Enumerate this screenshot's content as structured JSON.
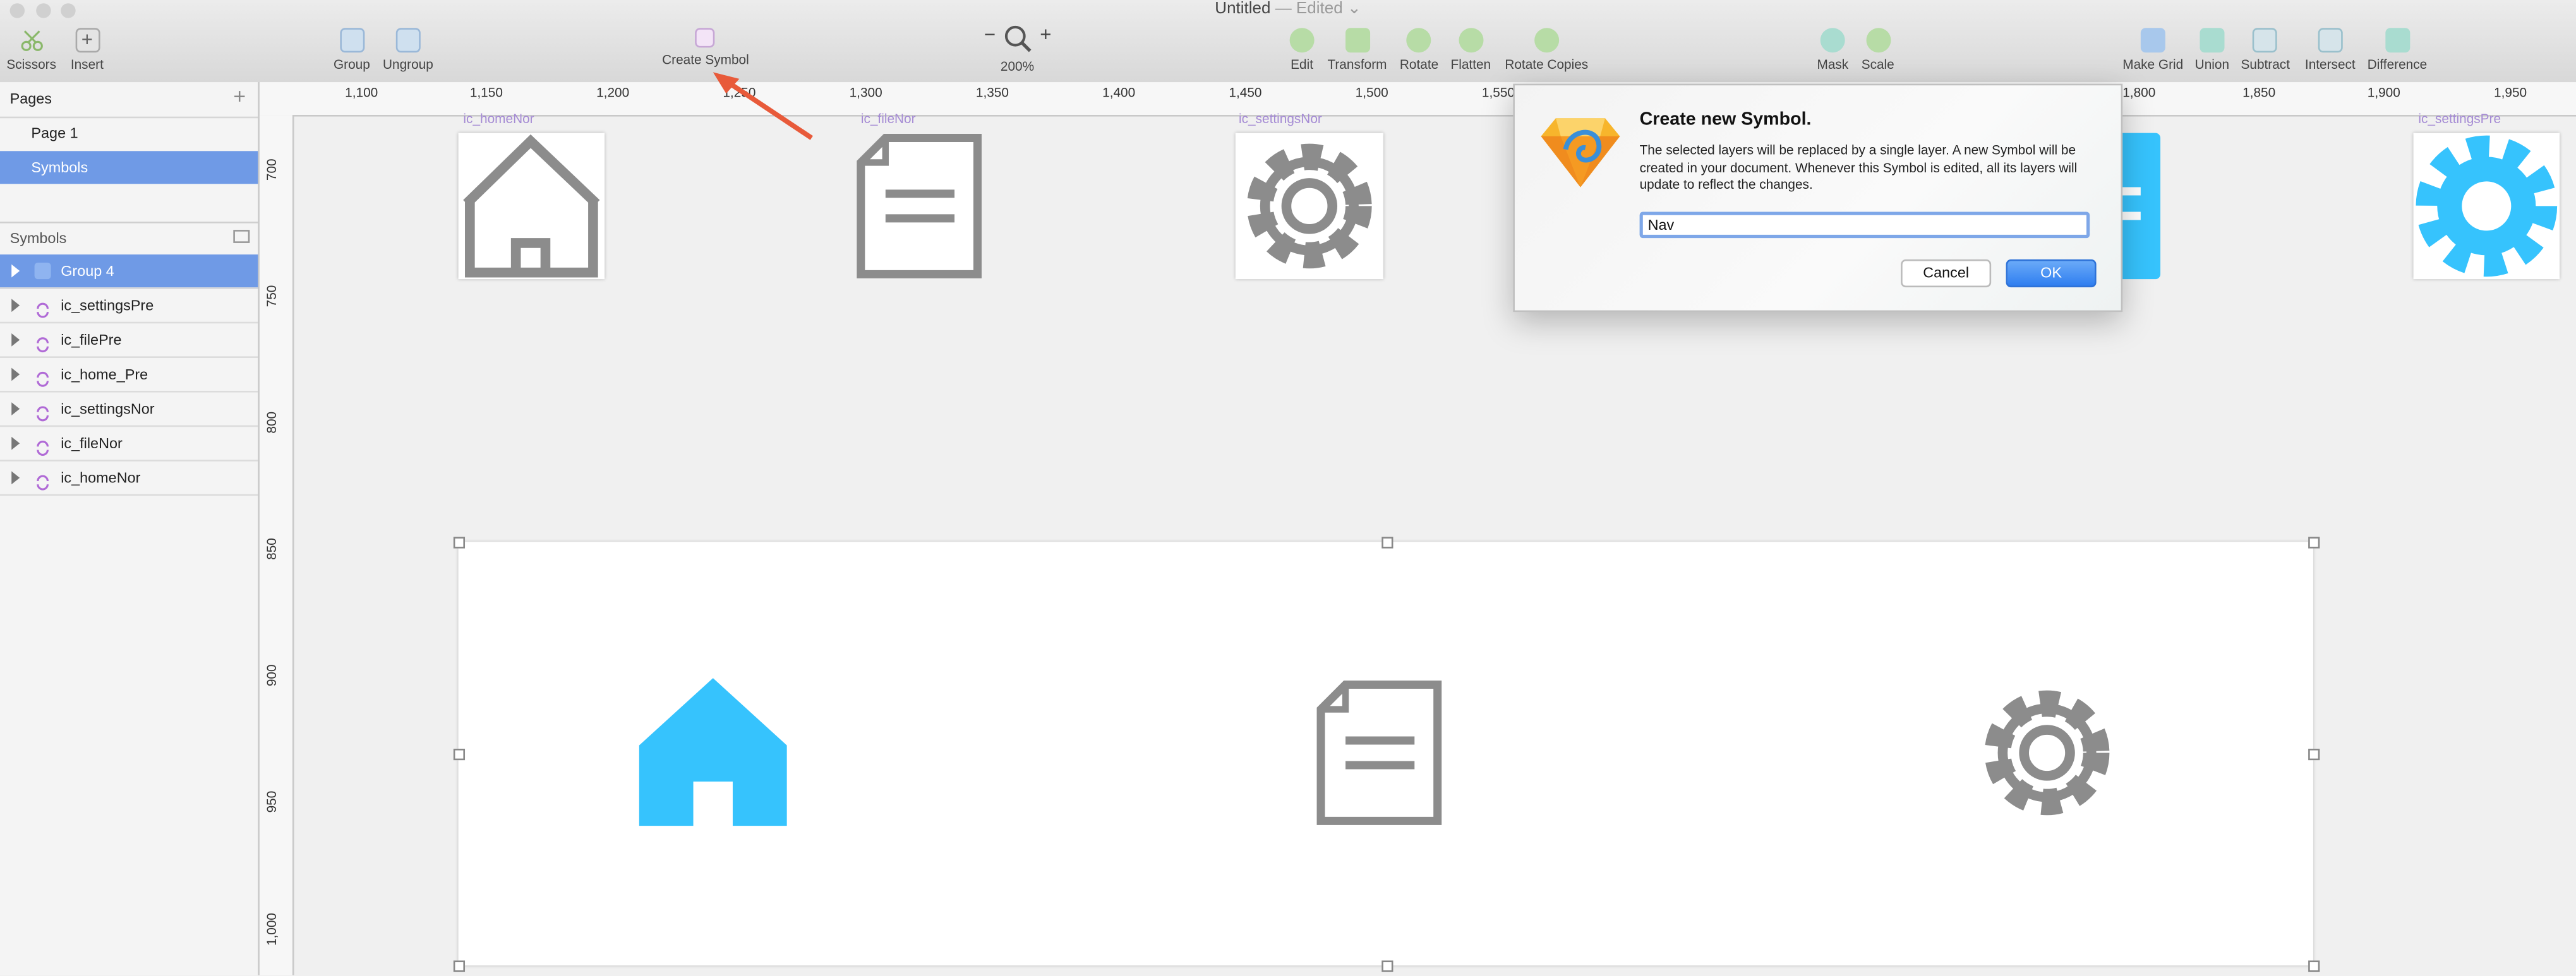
{
  "window": {
    "title": "Untitled",
    "status": " — Edited",
    "chevron": "⌄"
  },
  "toolbar": {
    "scissors": "Scissors",
    "insert": "Insert",
    "group": "Group",
    "ungroup": "Ungroup",
    "create_symbol": "Create Symbol",
    "zoom_out": "−",
    "zoom_in": "+",
    "zoom": "200%",
    "edit": "Edit",
    "transform": "Transform",
    "rotate": "Rotate",
    "flatten": "Flatten",
    "rotate_copies": "Rotate Copies",
    "mask": "Mask",
    "scale": "Scale",
    "make_grid": "Make Grid",
    "union": "Union",
    "subtract": "Subtract",
    "intersect": "Intersect",
    "difference": "Difference"
  },
  "pages": {
    "header": "Pages",
    "add": "+",
    "items": [
      "Page 1",
      "Symbols"
    ],
    "selected": "Symbols"
  },
  "symbols_panel": {
    "header": "Symbols",
    "layers": [
      "Group 4",
      "ic_settingsPre",
      "ic_filePre",
      "ic_home_Pre",
      "ic_settingsNor",
      "ic_fileNor",
      "ic_homeNor"
    ]
  },
  "ruler": {
    "top": [
      "1,100",
      "1,150",
      "1,200",
      "1,250",
      "1,300",
      "1,350",
      "1,400",
      "1,450",
      "1,500",
      "1,550",
      "1,800",
      "1,850",
      "1,900",
      "1,950"
    ],
    "left": [
      "700",
      "750",
      "800",
      "850",
      "900",
      "950",
      "1,000"
    ]
  },
  "artboards": {
    "ic_homeNor": "ic_homeNor",
    "ic_fileNor": "ic_fileNor",
    "ic_settingsNor": "ic_settingsNor",
    "ic_settingsPre": "ic_settingsPre"
  },
  "colors": {
    "icon_gray": "#8c8c8c",
    "icon_blue": "#36c3fd",
    "selection": "#6f9ae6",
    "accent": "#e85a3a"
  },
  "dialog": {
    "title": "Create new Symbol.",
    "message": "The selected layers will be replaced by a single layer. A new Symbol will be created in your document. Whenever this Symbol is edited, all its layers will update to reflect the changes.",
    "input_value": "Nav",
    "cancel": "Cancel",
    "ok": "OK"
  }
}
